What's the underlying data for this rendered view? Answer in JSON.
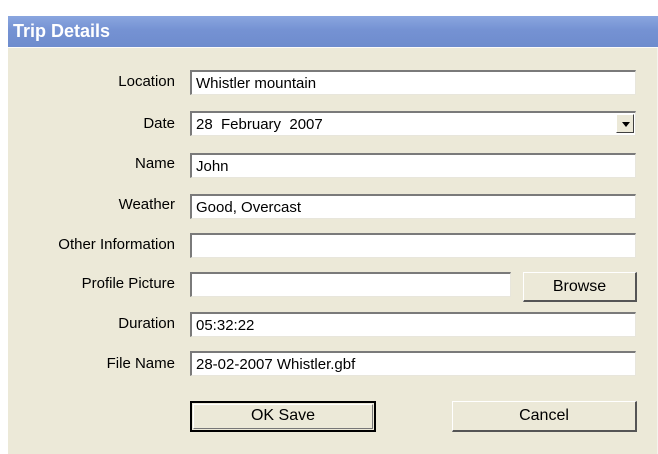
{
  "window": {
    "title": "Trip Details"
  },
  "form": {
    "location": {
      "label": "Location",
      "value": "Whistler mountain"
    },
    "date": {
      "label": "Date",
      "value": "28  February  2007"
    },
    "name": {
      "label": "Name",
      "value": "John"
    },
    "weather": {
      "label": "Weather",
      "value": "Good, Overcast"
    },
    "other": {
      "label": "Other Information",
      "value": ""
    },
    "profile": {
      "label": "Profile Picture",
      "value": "",
      "browse_label": "Browse"
    },
    "duration": {
      "label": "Duration",
      "value": "05:32:22"
    },
    "filename": {
      "label": "File Name",
      "value": "28-02-2007 Whistler.gbf"
    }
  },
  "buttons": {
    "ok_label": "OK Save",
    "cancel_label": "Cancel"
  },
  "icons": {
    "dropdown": "chevron-down-icon"
  },
  "colors": {
    "titlebar": "#7592d3",
    "dialog_bg": "#ece9d8"
  }
}
